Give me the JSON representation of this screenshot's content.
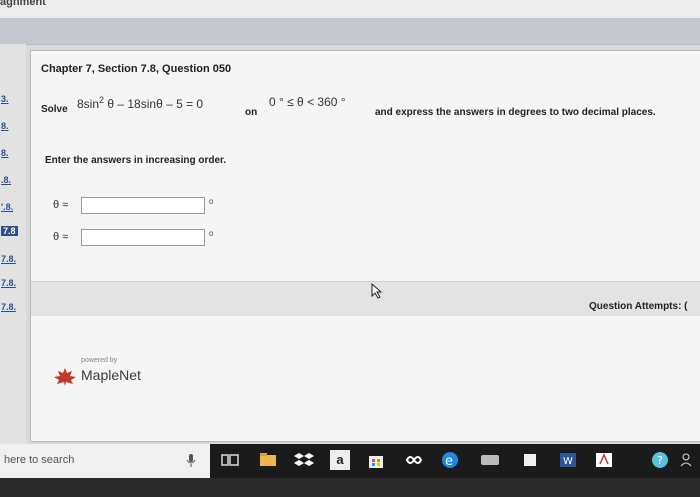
{
  "header": {
    "partial_title": "agnment"
  },
  "sidebar": {
    "items": [
      {
        "label": "3."
      },
      {
        "label": "8."
      },
      {
        "label": "8."
      },
      {
        "label": ".8."
      },
      {
        "label": "'.8."
      },
      {
        "label": "7.8",
        "active": true
      },
      {
        "label": "7.8."
      },
      {
        "label": "7.8."
      },
      {
        "label": "7.8."
      }
    ]
  },
  "question": {
    "title": "Chapter 7, Section 7.8, Question 050",
    "solve_label": "Solve",
    "equation": "8sin",
    "equation_exp": "2",
    "equation_rest": " θ – 18sinθ – 5 = 0",
    "on_label": "on",
    "domain": "0 ° ≤ θ < 360 °",
    "express_text": "and express the answers in degrees to two decimal places.",
    "instruction": "Enter the answers in increasing order.",
    "answers": [
      {
        "label": "θ ≈",
        "value": "",
        "unit": "o"
      },
      {
        "label": "θ ≈",
        "value": "",
        "unit": "o"
      }
    ]
  },
  "attempts_label": "Question Attempts: (",
  "branding": {
    "powered_by": "powered by",
    "name": "MapleNet"
  },
  "taskbar": {
    "search_placeholder": "here to search",
    "amazon_letter": "a"
  },
  "colors": {
    "accent": "#2a4f8a",
    "maple_red": "#c0392b",
    "edge_blue": "#1e88e5"
  }
}
